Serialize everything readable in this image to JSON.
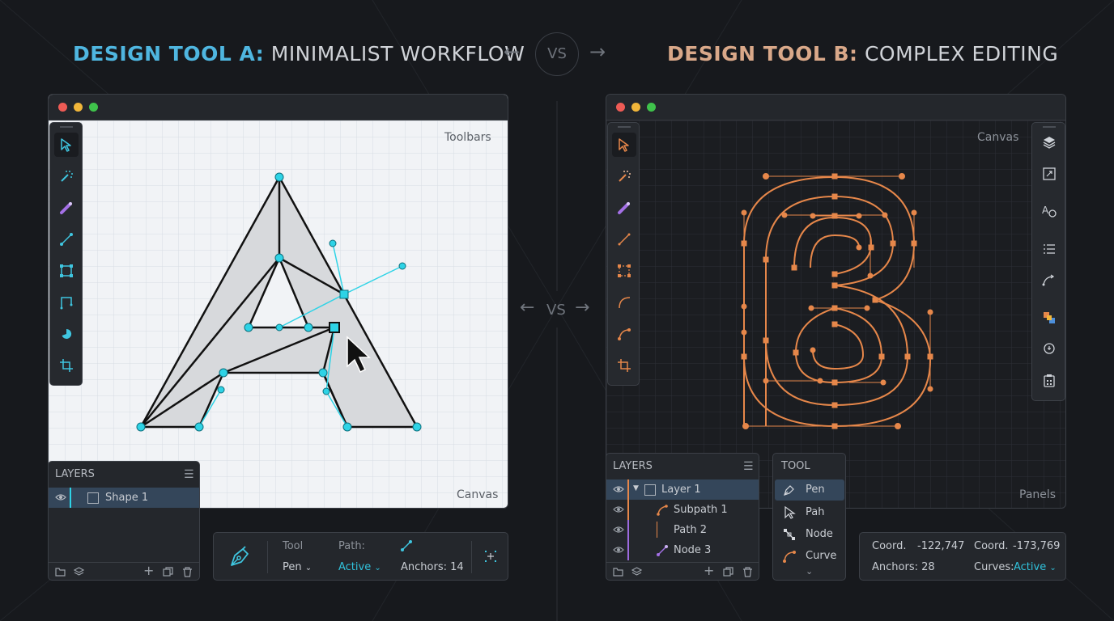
{
  "titles": {
    "left_bold": "DESIGN TOOL A:",
    "left_rest": " MINIMALIST WORKFLOW",
    "right_bold": "DESIGN TOOL B:",
    "right_rest": " COMPLEX EDITING",
    "vs_top": "VS",
    "vs_mid": "VS"
  },
  "colors": {
    "tool_a_accent": "#4fb6e0",
    "tool_b_accent": "#d9a889",
    "anchor_cyan": "#2ed3e6",
    "path_orange": "#e6874a",
    "layer_purple": "#9c6ade"
  },
  "left": {
    "canvas_label_top": "Toolbars",
    "canvas_label_bottom": "Canvas",
    "tools": [
      "select-arrow-icon",
      "magic-wand-icon",
      "brush-icon",
      "line-icon",
      "rectangle-icon",
      "corner-icon",
      "pie-icon",
      "crop-icon"
    ],
    "layers": {
      "header": "LAYERS",
      "items": [
        {
          "name": "Shape 1"
        }
      ]
    },
    "toolbar": {
      "tool_label": "Tool",
      "tool_value": "Pen",
      "path_label": "Path:",
      "path_value": "Active",
      "anchors_label": "Anchors: 14"
    }
  },
  "right": {
    "canvas_label_top": "Canvas",
    "canvas_label_bottom": "Panels",
    "layers": {
      "header": "LAYERS",
      "items": [
        {
          "name": "Layer 1"
        },
        {
          "name": "Subpath 1"
        },
        {
          "name": "Path 2"
        },
        {
          "name": "Node 3"
        }
      ]
    },
    "tool_panel": {
      "header": "TOOL",
      "items": [
        "Pen",
        "Pah",
        "Node",
        "Curve"
      ]
    },
    "coords": {
      "coord1_label": "Coord.",
      "coord1_value": "-122,747",
      "coord2_label": "Coord.",
      "coord2_value": "-173,769",
      "anchors_label": "Anchors: 28",
      "curves_label": "Curves:",
      "curves_value": "Active"
    }
  }
}
